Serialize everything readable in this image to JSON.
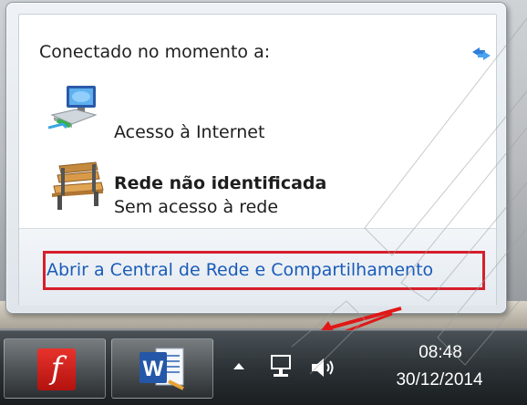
{
  "popup": {
    "header": "Conectado no momento a:",
    "networks": [
      {
        "name": "Acesso à Internet",
        "icon": "computer-network-icon"
      },
      {
        "name": "Rede não identificada",
        "status": "Sem acesso à rede",
        "icon": "park-bench-icon"
      }
    ],
    "footer_link": "Abrir a Central de Rede e Compartilhamento",
    "highlight_color": "#d61f2c",
    "link_color": "#1a5bb8"
  },
  "taskbar": {
    "pinned": [
      {
        "app": "Adobe Flash",
        "icon": "flash-icon",
        "glyph": "f"
      },
      {
        "app": "Microsoft Word",
        "icon": "word-icon",
        "glyph": "W"
      }
    ],
    "tray_icons": [
      "show-hidden-icons-arrow",
      "network-icon",
      "volume-icon"
    ],
    "clock": {
      "time": "08:48",
      "date": "30/12/2014"
    }
  }
}
